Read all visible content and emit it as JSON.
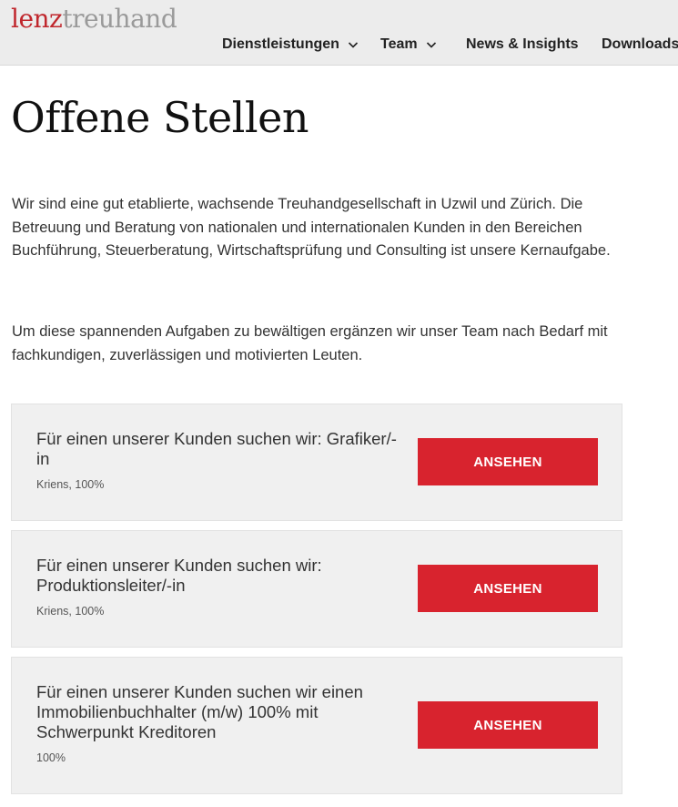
{
  "header": {
    "logo_part1": "lenz",
    "logo_part2": "treuhand",
    "nav": [
      {
        "label": "Dienstleistungen"
      },
      {
        "label": "Team"
      },
      {
        "label": "News & Insights"
      },
      {
        "label": "Downloads"
      }
    ]
  },
  "page": {
    "title": "Offene Stellen",
    "intro1": "Wir sind eine gut etablierte, wachsende Treuhandgesellschaft in Uzwil und Zürich. Die Betreuung und Beratung von nationalen und internationalen Kunden in den Bereichen Buchführung, Steuerberatung, Wirtschaftsprüfung und Consulting ist unsere Kernaufgabe.",
    "intro2": "Um diese spannenden Aufgaben zu bewältigen ergänzen wir unser Team nach Bedarf mit fachkundigen, zuverlässigen und motivierten Leuten."
  },
  "jobs": [
    {
      "title": "Für einen unserer Kunden suchen wir: Grafiker/-in",
      "meta": "Kriens, 100%",
      "button": "ANSEHEN"
    },
    {
      "title": "Für einen unserer Kunden suchen wir: Produktionsleiter/-in",
      "meta": "Kriens, 100%",
      "button": "ANSEHEN"
    },
    {
      "title": "Für einen unserer Kunden suchen wir einen Immobilienbuchhalter (m/w) 100% mit Schwerpunkt Kreditoren",
      "meta": "100%",
      "button": "ANSEHEN"
    }
  ],
  "colors": {
    "accent": "#d8232e",
    "logo_red": "#c0272d",
    "logo_gray": "#9a9a9a",
    "header_bg": "#ececec",
    "card_bg": "#f0f0f0"
  }
}
